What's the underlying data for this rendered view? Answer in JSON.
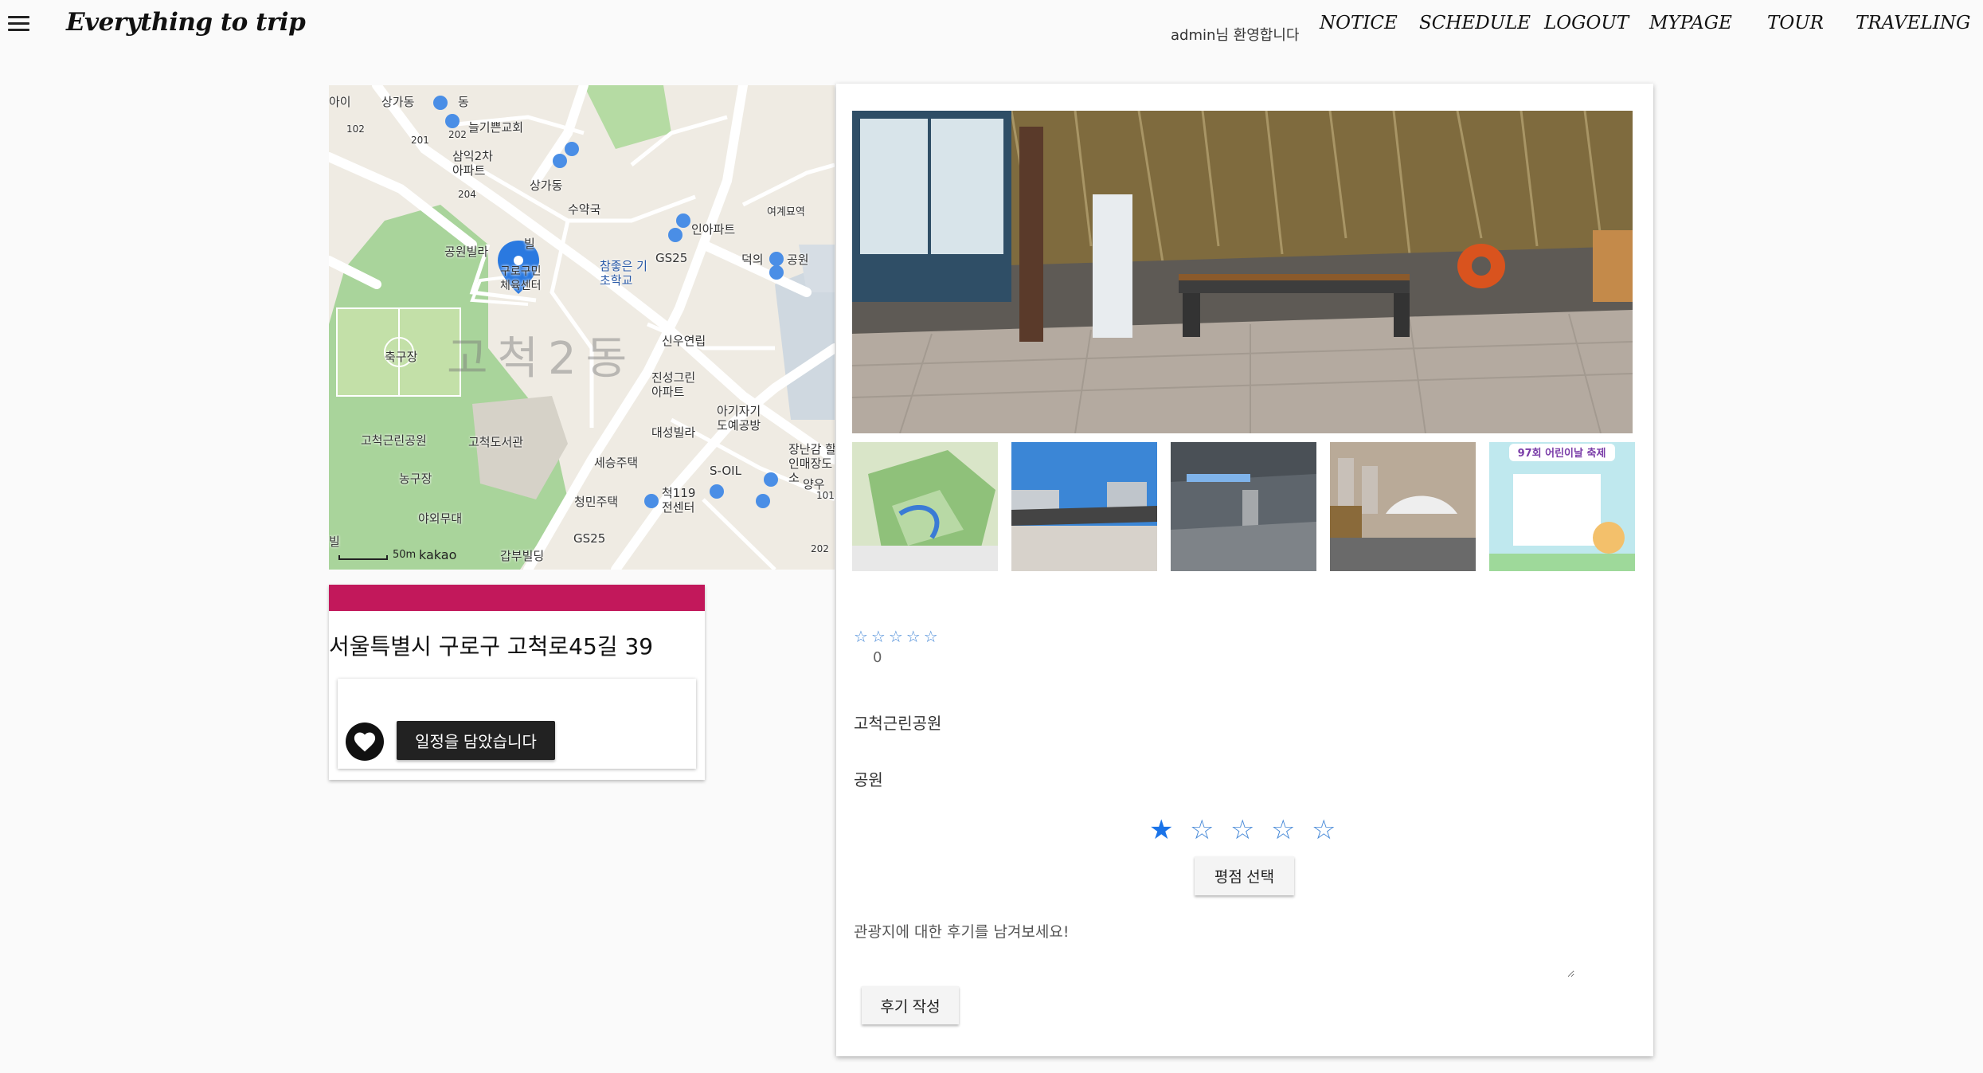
{
  "navbar": {
    "menu_icon": "hamburger-menu-icon",
    "brand": "Everything to trip",
    "welcome": "admin님 환영합니다",
    "links": [
      "NOTICE",
      "SCHEDULE",
      "LOGOUT",
      "MYPAGE",
      "TOUR",
      "TRAVELING"
    ]
  },
  "map": {
    "district": "고척2동",
    "labels": [
      "아이",
      "상가동",
      "동",
      "102",
      "201",
      "202",
      "늘기쁜교회",
      "삼익2차 아파트",
      "204",
      "상가동",
      "수약국",
      "인아파트",
      "여계묘역",
      "공원빌라",
      "빌",
      "구로구민 체육센터",
      "GS25",
      "참좋은 기초학교",
      "덕의",
      "공원",
      "신우연립",
      "축구장",
      "진성그린 아파트",
      "아기자기 도예공방",
      "고척근린공원",
      "고척도서관",
      "대성빌라",
      "장난감 할인매장도소",
      "세승주택",
      "S-OIL",
      "농구장",
      "척119 전센터",
      "양우",
      "101",
      "청민주택",
      "야외무대",
      "GS25",
      "202",
      "빌",
      "갑부빌딩"
    ],
    "scale": "50m",
    "provider": "kakao"
  },
  "location": {
    "address": "서울특별시 구로구 고척로45길 39",
    "heart_icon": "heart-icon",
    "schedule_button": "일정을 담았습니다"
  },
  "detail": {
    "rating_stars": "☆☆☆☆☆",
    "rating_count": "0",
    "place_name": "고척근린공원",
    "place_category": "공원",
    "rate_stars": [
      "★",
      "☆",
      "☆",
      "☆",
      "☆"
    ],
    "rate_button": "평점 선택",
    "review_placeholder": "관광지에 대한 후기를 남겨보세요!",
    "review_button": "후기 작성",
    "thumb_poster_text": "97회 어린이날 축제"
  },
  "colors": {
    "accent_bar": "#c2185b",
    "star_blue": "#1a73e8",
    "park_green": "#9fd08a"
  }
}
